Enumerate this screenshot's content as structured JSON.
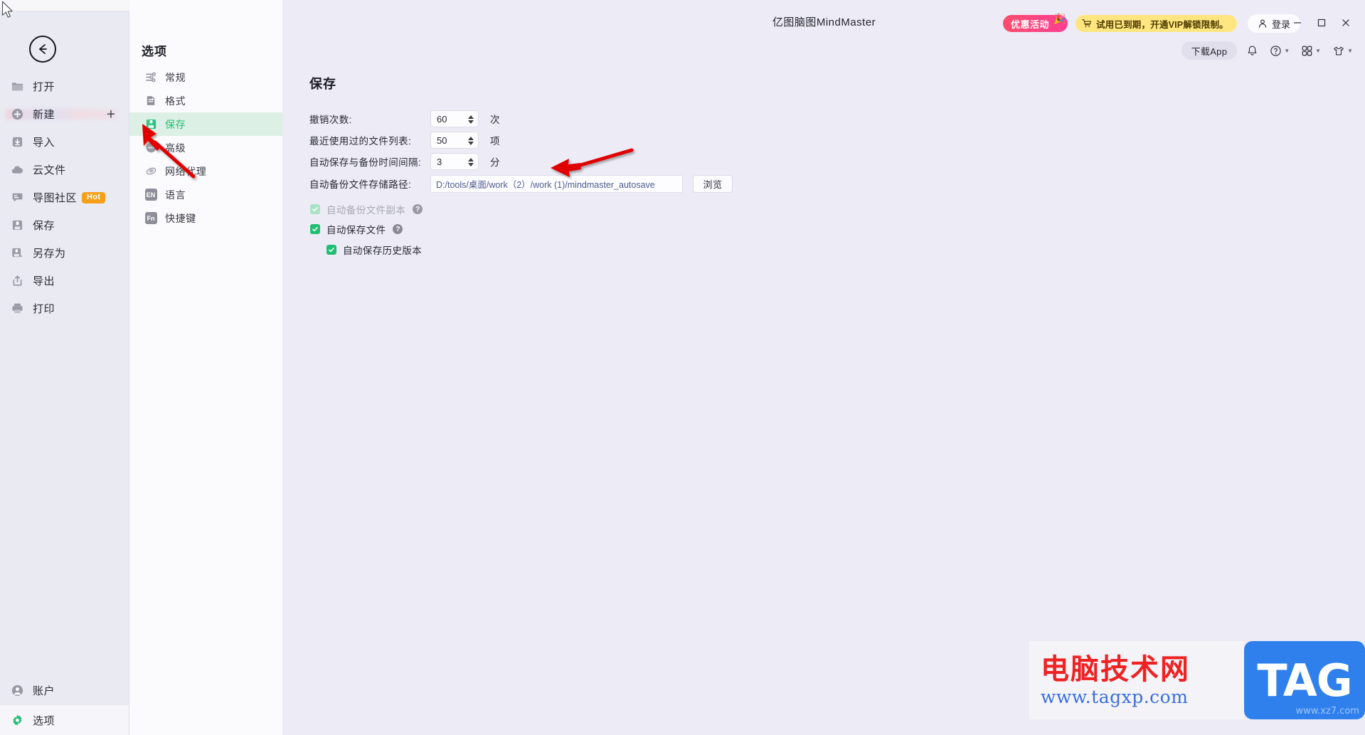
{
  "window": {
    "app_title": "亿图脑图MindMaster",
    "minimize_label": "最小化",
    "maximize_label": "最大化",
    "close_label": "关闭"
  },
  "header": {
    "promo_label": "优惠活动",
    "promo_icon": "sparkle-icon",
    "vip_label": "试用已到期，开通VIP解锁限制。",
    "vip_icon": "cart-icon",
    "login_label": "登录",
    "login_icon": "user-icon",
    "download_app_label": "下载App",
    "bell_icon": "bell-icon",
    "help_icon": "help-circle-icon",
    "apps_icon": "grid-apps-icon",
    "theme_icon": "shirt-icon",
    "accent_promo": "#ff4d6d",
    "accent_vip": "#ffe680"
  },
  "sidebar": {
    "back_icon": "back-arrow-icon",
    "items": [
      {
        "label": "打开",
        "icon": "folder-icon"
      },
      {
        "label": "新建",
        "icon": "plus-circle-icon",
        "trailing": "+"
      },
      {
        "label": "导入",
        "icon": "import-icon"
      },
      {
        "label": "云文件",
        "icon": "cloud-icon"
      },
      {
        "label": "导图社区",
        "icon": "community-icon",
        "badge": "Hot"
      },
      {
        "label": "保存",
        "icon": "save-icon"
      },
      {
        "label": "另存为",
        "icon": "save-as-icon"
      },
      {
        "label": "导出",
        "icon": "export-icon"
      },
      {
        "label": "打印",
        "icon": "print-icon"
      }
    ],
    "bottom_items": [
      {
        "label": "账户",
        "icon": "account-icon"
      },
      {
        "label": "选项",
        "icon": "gear-icon",
        "selected": true
      }
    ]
  },
  "options_panel": {
    "title": "选项",
    "items": [
      {
        "label": "常规",
        "icon": "general-sliders-icon",
        "active": false
      },
      {
        "label": "格式",
        "icon": "format-icon",
        "active": false
      },
      {
        "label": "保存",
        "icon": "floppy-save-icon",
        "active": true
      },
      {
        "label": "高级",
        "icon": "dots-circle-icon",
        "active": false
      },
      {
        "label": "网络代理",
        "icon": "network-proxy-icon",
        "active": false
      },
      {
        "label": "语言",
        "icon": "language-en-icon",
        "active": false,
        "glyph": "EN"
      },
      {
        "label": "快捷键",
        "icon": "shortcut-fn-icon",
        "active": false,
        "glyph": "Fn"
      }
    ],
    "active_color": "#21bf73",
    "active_bg": "#ddf0e6"
  },
  "save_page": {
    "title": "保存",
    "fields": [
      {
        "label": "撤销次数:",
        "value": "60",
        "unit": "次",
        "name": "undo-count"
      },
      {
        "label": "最近使用过的文件列表:",
        "value": "50",
        "unit": "项",
        "name": "recent-files-count"
      },
      {
        "label": "自动保存与备份时间间隔:",
        "value": "3",
        "unit": "分",
        "name": "autosave-interval"
      }
    ],
    "path_row": {
      "label": "自动备份文件存储路径:",
      "value": "D:/tools/桌面/work（2）/work (1)/mindmaster_autosave",
      "placeholder": "",
      "browse_label": "浏览"
    },
    "checkboxes": [
      {
        "label": "自动备份文件副本",
        "checked": true,
        "disabled": true,
        "help": "?",
        "name": "auto-backup-copy"
      },
      {
        "label": "自动保存文件",
        "checked": true,
        "disabled": false,
        "help": "?",
        "name": "auto-save-file"
      },
      {
        "label": "自动保存历史版本",
        "checked": true,
        "disabled": false,
        "indent": true,
        "name": "auto-save-history"
      }
    ]
  },
  "annotations": {
    "arrow_color": "#e00000",
    "arrow_1_target": "options-item-save",
    "arrow_2_target": "autosave-interval-field"
  },
  "watermark": {
    "cn_text": "电脑技术网",
    "url_text": "www.tagxp.com",
    "tag_text": "TAG",
    "sub_text": "www.xz7.com"
  }
}
